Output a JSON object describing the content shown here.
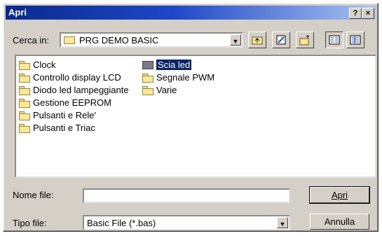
{
  "window": {
    "title": "Apri",
    "help_label": "?",
    "close_label": "×"
  },
  "lookin": {
    "label": "Cerca in:",
    "value": "PRG DEMO BASIC"
  },
  "toolbar": {
    "icons": [
      "up-one-level-icon",
      "desktop-icon",
      "new-folder-icon",
      "list-view-icon",
      "details-view-icon"
    ]
  },
  "files": [
    {
      "name": "Clock",
      "selected": false
    },
    {
      "name": "Controllo display LCD",
      "selected": false
    },
    {
      "name": "Diodo led lampeggiante",
      "selected": false
    },
    {
      "name": "Gestione EEPROM",
      "selected": false
    },
    {
      "name": "Pulsanti e Rele'",
      "selected": false
    },
    {
      "name": "Pulsanti e Triac",
      "selected": false
    },
    {
      "name": "Scia led",
      "selected": true
    },
    {
      "name": "Segnale PWM",
      "selected": false
    },
    {
      "name": "Varie",
      "selected": false
    }
  ],
  "filename": {
    "label": "Nome file:",
    "value": ""
  },
  "filetype": {
    "label": "Tipo file:",
    "value": "Basic File (*.bas)"
  },
  "buttons": {
    "open": "Apri",
    "cancel": "Annulla"
  }
}
